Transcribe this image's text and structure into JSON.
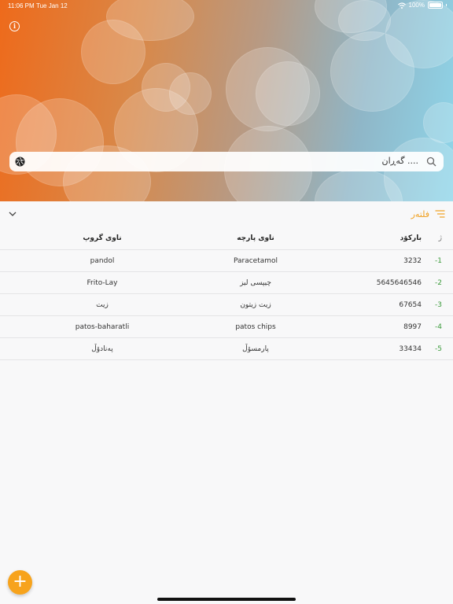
{
  "status_bar": {
    "time": "11:06 PM",
    "date": "Tue Jan 12",
    "battery": "100%"
  },
  "search": {
    "placeholder": "گەڕان ...."
  },
  "filter": {
    "label": "فلتەر"
  },
  "table": {
    "headers": {
      "number": "ژ",
      "barcode": "بارکۆد",
      "item_name": "ناوی پارچە",
      "group_name": "ناوی گروپ"
    },
    "rows": [
      {
        "number": "-1",
        "barcode": "3232",
        "item_name": "Paracetamol",
        "group_name": "pandol"
      },
      {
        "number": "-2",
        "barcode": "5645646546",
        "item_name": "چیپسی لیز",
        "group_name": "Frito-Lay"
      },
      {
        "number": "-3",
        "barcode": "67654",
        "item_name": "زیت زیتون",
        "group_name": "زیت"
      },
      {
        "number": "-4",
        "barcode": "8997",
        "item_name": "patos chips",
        "group_name": "patos-baharatli"
      },
      {
        "number": "-5",
        "barcode": "33434",
        "item_name": "پارمسۆڵ",
        "group_name": "پەنادۆڵ"
      }
    ]
  },
  "fab": {
    "label": "+"
  },
  "colors": {
    "accent": "#f7a31c",
    "row_number": "#3a9a3a"
  },
  "icons": {
    "info": "info-icon",
    "camera": "camera-aperture-icon",
    "search": "search-icon",
    "filter": "filter-lines-icon",
    "chevron": "chevron-down-icon"
  }
}
